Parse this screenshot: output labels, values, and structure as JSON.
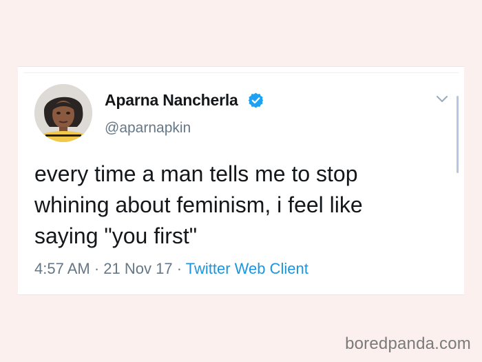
{
  "tweet": {
    "author": {
      "name": "Aparna Nancherla",
      "handle": "@aparnapkin",
      "verified": true,
      "avatar_icon": "profile-photo"
    },
    "text": "every time a man tells me to stop\nwhining about feminism, i feel like\nsaying \"you first\"",
    "time": "4:57 AM",
    "separator": " · ",
    "date": "21 Nov 17",
    "source": "Twitter Web Client",
    "menu_icon": "chevron-down-icon"
  },
  "colors": {
    "background": "#fcf0ee",
    "card": "#ffffff",
    "text": "#14171a",
    "muted": "#657786",
    "link": "#1b95e0",
    "verified": "#1da1f2"
  },
  "watermark": {
    "text": "boredpanda.com"
  }
}
